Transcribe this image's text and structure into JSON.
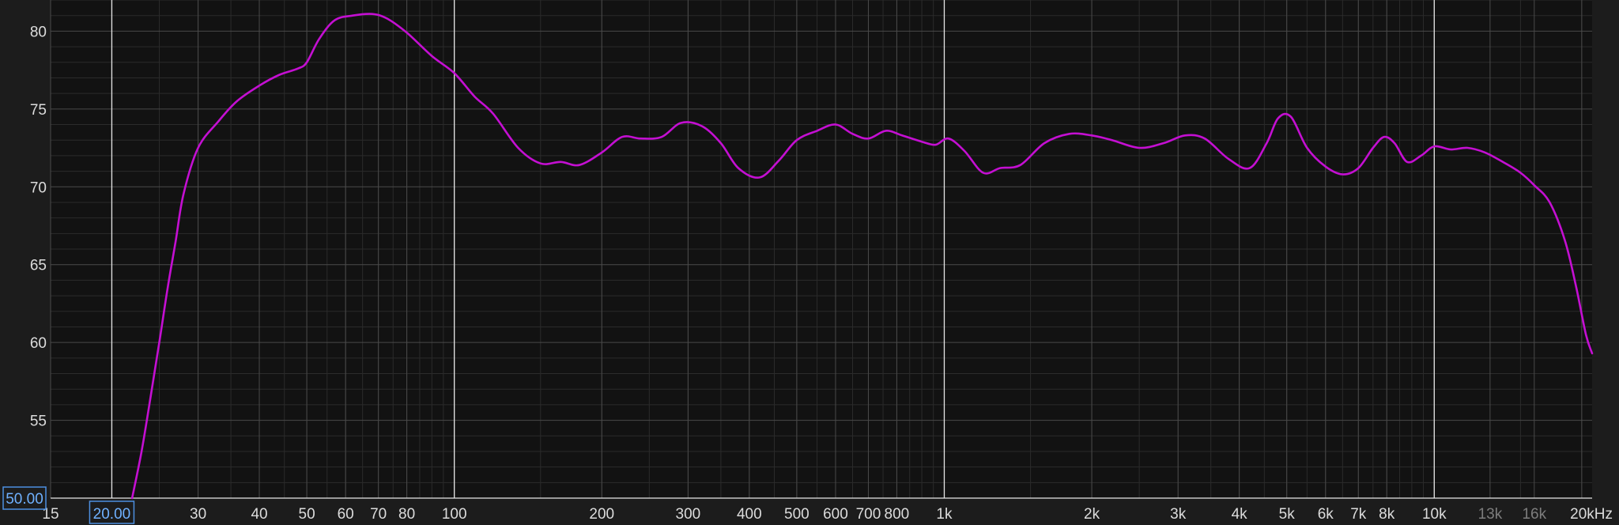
{
  "chart_data": {
    "type": "line",
    "title": "",
    "xlabel": "",
    "ylabel": "",
    "x_scale": "log",
    "xlim": [
      15,
      21000
    ],
    "ylim": [
      50,
      82
    ],
    "grid": true,
    "colors": {
      "background": "#121212",
      "frame": "#1c1c1c",
      "grid_major": "#4a4a4a",
      "grid_minor": "#2b2b2b",
      "marker_line": "#e6e6e6",
      "series": "#c40fd2",
      "range_box": "#4d8fe0"
    },
    "y_ticks": [
      {
        "value": 55,
        "label": "55"
      },
      {
        "value": 60,
        "label": "60"
      },
      {
        "value": 65,
        "label": "65"
      },
      {
        "value": 70,
        "label": "70"
      },
      {
        "value": 75,
        "label": "75"
      },
      {
        "value": 80,
        "label": "80"
      }
    ],
    "x_ticks": [
      {
        "value": 15,
        "label": "15",
        "dim": false
      },
      {
        "value": 30,
        "label": "30",
        "dim": false
      },
      {
        "value": 40,
        "label": "40",
        "dim": false
      },
      {
        "value": 50,
        "label": "50",
        "dim": false
      },
      {
        "value": 60,
        "label": "60",
        "dim": false
      },
      {
        "value": 70,
        "label": "70",
        "dim": false
      },
      {
        "value": 80,
        "label": "80",
        "dim": false
      },
      {
        "value": 100,
        "label": "100",
        "dim": false
      },
      {
        "value": 200,
        "label": "200",
        "dim": false
      },
      {
        "value": 300,
        "label": "300",
        "dim": false
      },
      {
        "value": 400,
        "label": "400",
        "dim": false
      },
      {
        "value": 500,
        "label": "500",
        "dim": false
      },
      {
        "value": 600,
        "label": "600",
        "dim": false
      },
      {
        "value": 700,
        "label": "700",
        "dim": false
      },
      {
        "value": 800,
        "label": "800",
        "dim": false
      },
      {
        "value": 1000,
        "label": "1k",
        "dim": false
      },
      {
        "value": 2000,
        "label": "2k",
        "dim": false
      },
      {
        "value": 3000,
        "label": "3k",
        "dim": false
      },
      {
        "value": 4000,
        "label": "4k",
        "dim": false
      },
      {
        "value": 5000,
        "label": "5k",
        "dim": false
      },
      {
        "value": 6000,
        "label": "6k",
        "dim": false
      },
      {
        "value": 7000,
        "label": "7k",
        "dim": false
      },
      {
        "value": 8000,
        "label": "8k",
        "dim": false
      },
      {
        "value": 10000,
        "label": "10k",
        "dim": false
      },
      {
        "value": 13000,
        "label": "13k",
        "dim": true
      },
      {
        "value": 16000,
        "label": "16k",
        "dim": true
      },
      {
        "value": 20000,
        "label": "20kHz",
        "dim": false
      }
    ],
    "marker_lines_x": [
      20,
      100,
      1000,
      10000
    ],
    "range_labels": {
      "x_min": "20.00",
      "y_min": "50.00"
    },
    "series": [
      {
        "x": [
          22,
          23,
          24,
          25,
          26,
          27,
          28,
          30,
          33,
          36,
          40,
          44,
          48,
          50,
          53,
          57,
          62,
          68,
          73,
          80,
          90,
          100,
          110,
          120,
          135,
          150,
          165,
          180,
          200,
          220,
          240,
          265,
          290,
          320,
          350,
          380,
          420,
          460,
          500,
          550,
          600,
          650,
          700,
          760,
          820,
          900,
          960,
          1020,
          1100,
          1200,
          1300,
          1430,
          1600,
          1800,
          2000,
          2200,
          2500,
          2800,
          3100,
          3400,
          3800,
          4200,
          4550,
          4800,
          5100,
          5500,
          6000,
          6500,
          7000,
          7500,
          7900,
          8300,
          8800,
          9400,
          10000,
          10800,
          11700,
          12700,
          13800,
          15000,
          16000,
          17200,
          18500,
          19500,
          20400,
          21000
        ],
        "y": [
          50.0,
          53.0,
          56.5,
          60.0,
          63.5,
          66.5,
          69.5,
          72.5,
          74.2,
          75.5,
          76.5,
          77.2,
          77.6,
          78.0,
          79.5,
          80.7,
          81.0,
          81.1,
          80.8,
          79.9,
          78.4,
          77.3,
          75.8,
          74.7,
          72.5,
          71.5,
          71.6,
          71.4,
          72.2,
          73.2,
          73.1,
          73.2,
          74.1,
          73.9,
          72.8,
          71.2,
          70.6,
          71.7,
          73.0,
          73.6,
          74.0,
          73.4,
          73.1,
          73.6,
          73.3,
          72.9,
          72.7,
          73.1,
          72.3,
          70.9,
          71.2,
          71.4,
          72.8,
          73.4,
          73.3,
          73.0,
          72.5,
          72.8,
          73.3,
          73.1,
          71.8,
          71.2,
          72.8,
          74.4,
          74.5,
          72.5,
          71.3,
          70.8,
          71.2,
          72.5,
          73.2,
          72.8,
          71.6,
          72.0,
          72.6,
          72.4,
          72.5,
          72.2,
          71.6,
          70.9,
          70.1,
          69.0,
          66.5,
          63.5,
          60.5,
          59.3
        ]
      }
    ]
  }
}
